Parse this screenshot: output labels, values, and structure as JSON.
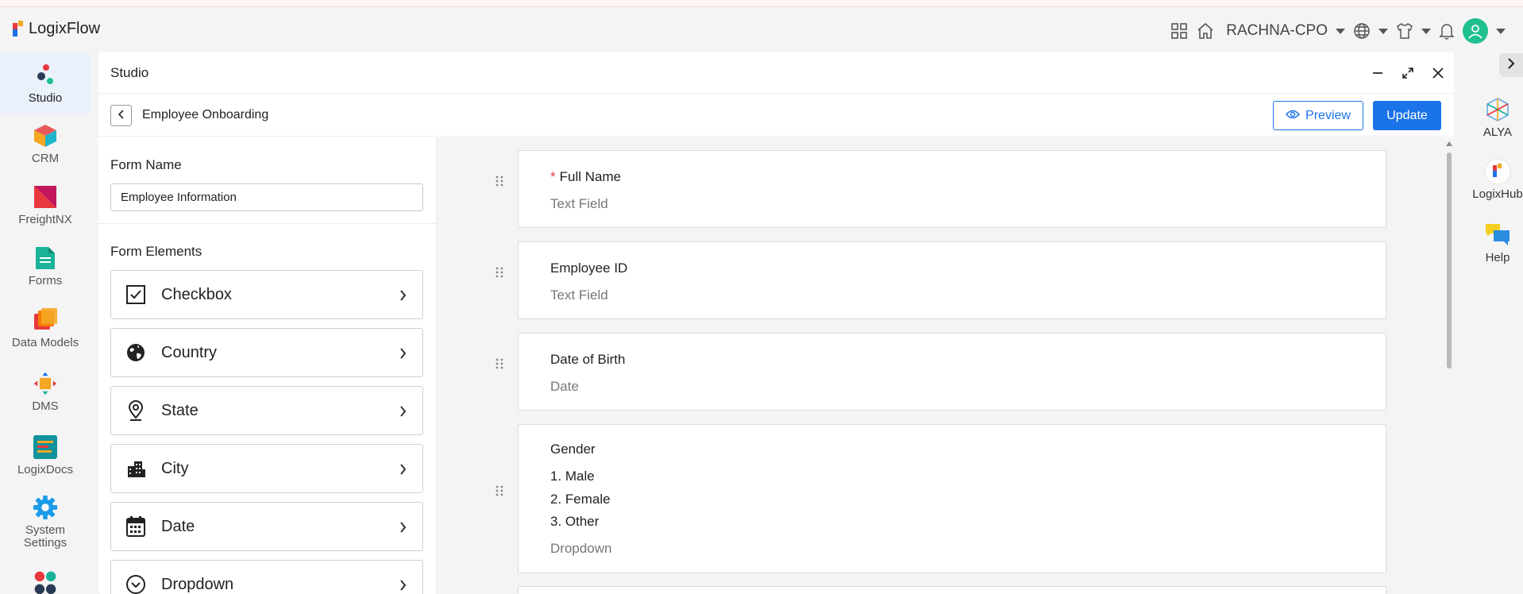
{
  "app": {
    "name": "LogixFlow"
  },
  "topbar": {
    "tenant": "RACHNA-CPO"
  },
  "left_nav": [
    {
      "label": "Studio",
      "icon": "studio-icon"
    },
    {
      "label": "CRM",
      "icon": "crm-icon"
    },
    {
      "label": "FreightNX",
      "icon": "freightnx-icon"
    },
    {
      "label": "Forms",
      "icon": "forms-icon"
    },
    {
      "label": "Data Models",
      "icon": "data-models-icon"
    },
    {
      "label": "DMS",
      "icon": "dms-icon"
    },
    {
      "label": "LogixDocs",
      "icon": "logixdocs-icon"
    },
    {
      "label": "System Settings",
      "icon": "gear-icon"
    }
  ],
  "right_nav": [
    {
      "label": "ALYA",
      "icon": "alya-icon"
    },
    {
      "label": "LogixHub",
      "icon": "logixhub-icon"
    },
    {
      "label": "Help",
      "icon": "chat-icon"
    }
  ],
  "panel": {
    "title": "Studio",
    "breadcrumb": "Employee Onboarding",
    "preview_label": "Preview",
    "update_label": "Update"
  },
  "form": {
    "name_label": "Form Name",
    "name_value": "Employee Information",
    "elements_label": "Form Elements",
    "elements": [
      {
        "label": "Checkbox",
        "icon": "checkbox-icon"
      },
      {
        "label": "Country",
        "icon": "globe-icon"
      },
      {
        "label": "State",
        "icon": "location-pin-icon"
      },
      {
        "label": "City",
        "icon": "city-icon"
      },
      {
        "label": "Date",
        "icon": "calendar-icon"
      },
      {
        "label": "Dropdown",
        "icon": "dropdown-circle-icon"
      }
    ]
  },
  "fields": [
    {
      "label": "Full Name",
      "required": "*",
      "type": "Text Field"
    },
    {
      "label": "Employee ID",
      "type": "Text Field"
    },
    {
      "label": "Date of Birth",
      "type": "Date"
    },
    {
      "label": "Gender",
      "type": "Dropdown",
      "options": [
        "1. Male",
        "2. Female",
        "3. Other"
      ]
    }
  ],
  "colors": {
    "primary": "#1a73e8",
    "required": "#e53935",
    "avatar": "#1fbf8f"
  }
}
